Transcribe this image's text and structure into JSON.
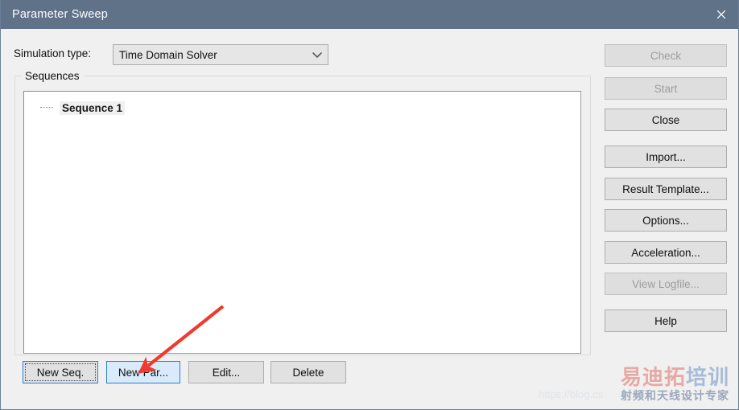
{
  "window": {
    "title": "Parameter Sweep",
    "close_icon": "close-icon"
  },
  "form": {
    "simulation_type_label": "Simulation type:",
    "simulation_type_value": "Time Domain Solver",
    "simulation_type_arrow_icon": "chevron-down-icon"
  },
  "sequences": {
    "groupbox_title": "Sequences",
    "items": [
      {
        "label": "Sequence 1"
      }
    ]
  },
  "bottom_buttons": [
    {
      "label": "New Seq.",
      "name": "new-seq-button",
      "state": "focused"
    },
    {
      "label": "New Par...",
      "name": "new-par-button",
      "state": "hovered"
    },
    {
      "label": "Edit...",
      "name": "edit-button",
      "state": "normal"
    },
    {
      "label": "Delete",
      "name": "delete-button",
      "state": "normal"
    }
  ],
  "side_buttons": [
    {
      "label": "Check",
      "name": "check-button",
      "state": "disabled"
    },
    {
      "label": "Start",
      "name": "start-button",
      "state": "disabled"
    },
    {
      "label": "Close",
      "name": "close-button",
      "state": "normal"
    },
    {
      "label": "Import...",
      "name": "import-button",
      "state": "normal"
    },
    {
      "label": "Result Template...",
      "name": "result-template-button",
      "state": "normal"
    },
    {
      "label": "Options...",
      "name": "options-button",
      "state": "normal"
    },
    {
      "label": "Acceleration...",
      "name": "acceleration-button",
      "state": "normal"
    },
    {
      "label": "View Logfile...",
      "name": "view-logfile-button",
      "state": "disabled"
    },
    {
      "label": "Help",
      "name": "help-button",
      "state": "normal"
    }
  ],
  "watermark": {
    "line1_part1": "易迪拓",
    "line1_part2": "培训",
    "line2": "射频和天线设计专家",
    "url": "https://blog.cs"
  },
  "colors": {
    "titlebar": "#5f7288",
    "dialog_bg": "#f0f0f0",
    "button_face": "#e1e1e1",
    "accent_focus": "#2a7fd4",
    "hover_fill": "#d9ebfb",
    "annotation_arrow": "#ee3b2e",
    "disabled_text": "#9d9d9d"
  }
}
